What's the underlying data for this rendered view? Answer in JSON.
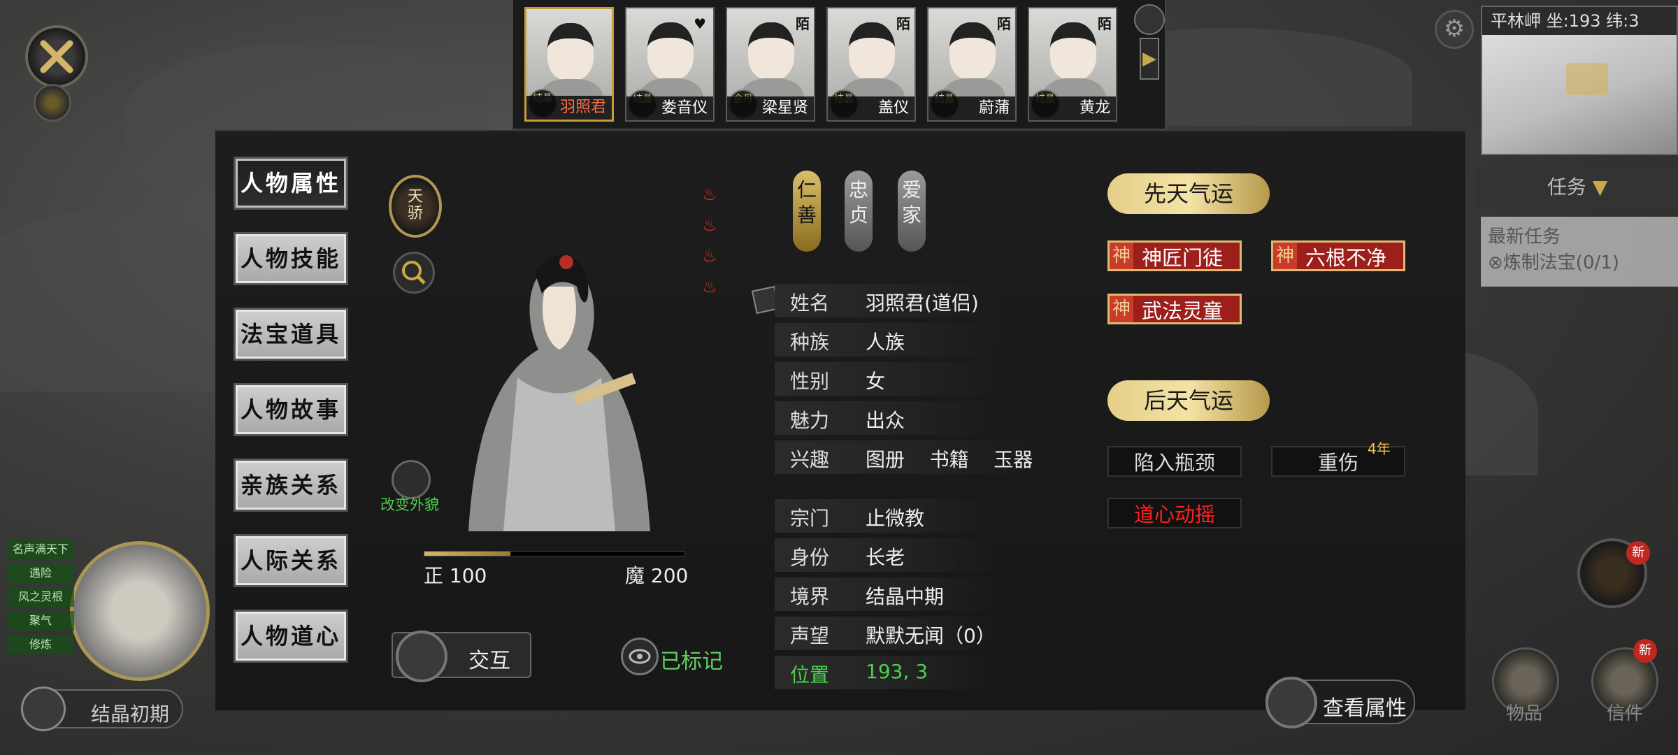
{
  "top_bar": {
    "portraits": [
      {
        "name": "羽照君",
        "rank": "结晶",
        "selected": true
      },
      {
        "name": "娄音仪",
        "rank": "结晶",
        "selected": false
      },
      {
        "name": "梁星贤",
        "rank": "金丹",
        "selected": false,
        "tag": "陌"
      },
      {
        "name": "盖仪",
        "rank": "结晶",
        "selected": false,
        "tag": "陌"
      },
      {
        "name": "蔚蒲",
        "rank": "结晶",
        "selected": false,
        "tag": "陌"
      },
      {
        "name": "黄龙",
        "rank": "结晶",
        "selected": false,
        "tag": "陌"
      }
    ],
    "next_arrow": "▶"
  },
  "minimap": {
    "header": "平林岬 坐:193 纬:3",
    "sub": "平林岬"
  },
  "quest": {
    "tab_label": "任务",
    "title": "最新任务",
    "item": "炼制法宝(0/1)"
  },
  "sidebar_tabs": [
    {
      "label": "人物属性",
      "active": true
    },
    {
      "label": "人物技能",
      "active": false
    },
    {
      "label": "法宝道具",
      "active": false
    },
    {
      "label": "人物故事",
      "active": false
    },
    {
      "label": "亲族关系",
      "active": false
    },
    {
      "label": "人际关系",
      "active": false
    },
    {
      "label": "人物道心",
      "active": false
    }
  ],
  "character": {
    "talent_badge": "天骄",
    "change_appearance": "改变外貌",
    "alignment": {
      "good_label": "正 100",
      "evil_label": "魔 200",
      "good_fraction": 0.33
    },
    "interact_label": "交互",
    "marked_label": "已标记"
  },
  "virtues": [
    "仁善",
    "忠贞",
    "爱家"
  ],
  "attributes": [
    {
      "key": "姓名",
      "value": "羽照君(道侣)"
    },
    {
      "key": "种族",
      "value": "人族"
    },
    {
      "key": "性别",
      "value": "女"
    },
    {
      "key": "魅力",
      "value": "出众"
    },
    {
      "key": "兴趣",
      "value": "图册    书籍    玉器"
    },
    {
      "key": "宗门",
      "value": "止微教"
    },
    {
      "key": "身份",
      "value": "长老"
    },
    {
      "key": "境界",
      "value": "结晶中期"
    },
    {
      "key": "声望",
      "value": "默默无闻（0）"
    },
    {
      "key": "位置",
      "value": "193, 3",
      "highlight": true
    }
  ],
  "fortune": {
    "innate_title": "先天气运",
    "innate": [
      "神匠门徒",
      "六根不净",
      "武法灵童"
    ],
    "shen_mark": "神",
    "acquired_title": "后天气运",
    "acquired": [
      "陷入瓶颈",
      "重伤",
      "道心动摇"
    ],
    "years_label": "4年"
  },
  "view_attributes_label": "查看属性",
  "bottom_right": {
    "items_label": "物品",
    "letters_label": "信件",
    "new_badge": "新"
  },
  "bottom_left": {
    "realm_label": "结晶初期",
    "tags": [
      "名声满天下",
      "遇险",
      "风之灵根",
      "聚气",
      "修炼"
    ]
  },
  "colors": {
    "gold": "#e4cf89",
    "red": "#9c1f1c",
    "green": "#49d149",
    "alert": "#ff2020"
  }
}
